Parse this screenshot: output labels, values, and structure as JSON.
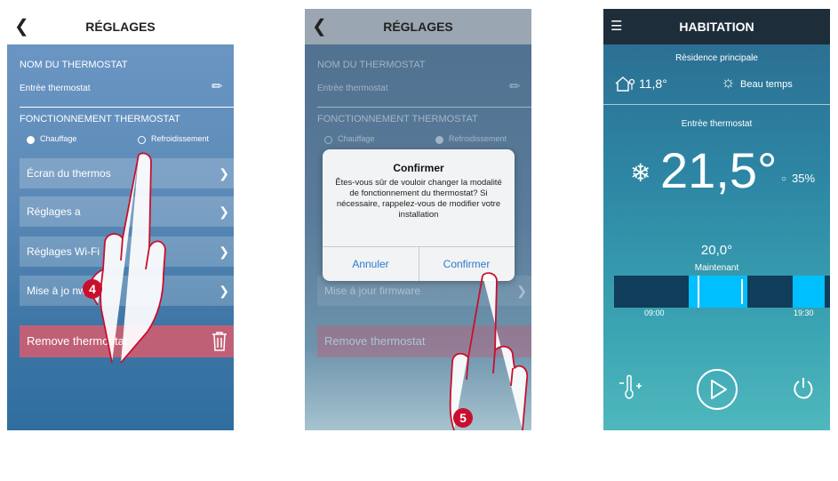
{
  "screen1": {
    "header_title": "RÉGLAGES",
    "name_section": "NOM DU THERMOSTAT",
    "thermostat_name": "Entrèe thermostat",
    "mode_section": "FONCTIONNEMENT THERMOSTAT",
    "mode_heat": "Chauffage",
    "mode_cool": "Refroidissement",
    "rows": [
      "Écran du thermos",
      "Réglages a",
      "Réglages Wi-Fi",
      "Mise à jo  nware"
    ],
    "remove_label": "Remove thermostat",
    "step_badge": "4"
  },
  "screen2": {
    "header_title": "RÉGLAGES",
    "name_section": "NOM DU THERMOSTAT",
    "thermostat_name": "Entrèe thermostat",
    "mode_section": "FONCTIONNEMENT THERMOSTAT",
    "mode_heat": "Chauffage",
    "mode_cool": "Refroidissement",
    "firmware_row": "Mise à jour firmware",
    "remove_label": "Remove thermostat",
    "dialog": {
      "title": "Confirmer",
      "body": "Êtes-vous sûr de vouloir changer la modalité de fonctionnement du thermostat? Si nécessaire, rappelez-vous de modifier votre installation",
      "cancel": "Annuler",
      "confirm": "Confirmer"
    },
    "step_badge": "5"
  },
  "screen3": {
    "header_title": "HABITATION",
    "residence": "Rèsidence principale",
    "outdoor_temp": "11,8°",
    "weather": "Beau temps",
    "zone_name": "Entrèe thermostat",
    "current_temp": "21,5°",
    "humidity": "35%",
    "setpoint": "20,0°",
    "setpoint_label": "Maintenant",
    "time_start": "09:00",
    "time_end": "19:30"
  },
  "colors": {
    "accent_blue": "#2a7bd0",
    "remove_red": "#c06077",
    "badge_red": "#c8102e",
    "timeline_dark": "#0f3d5a",
    "timeline_light": "#00bfff"
  }
}
